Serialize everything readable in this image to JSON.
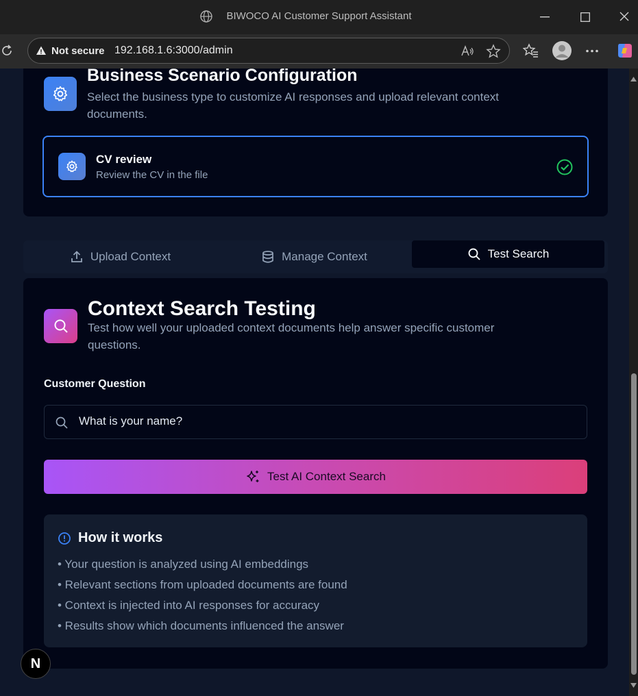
{
  "window": {
    "title": "BIWOCO AI Customer Support Assistant"
  },
  "browser": {
    "security_label": "Not secure",
    "url": "192.168.1.6:3000/admin"
  },
  "business_config": {
    "title": "Business Scenario Configuration",
    "subtitle_line1": "Select the business type to customize AI responses and upload relevant context",
    "subtitle_line2": "documents.",
    "selected_option": {
      "title": "CV review",
      "description": "Review the CV in the file"
    }
  },
  "tabs": [
    {
      "label": "Upload Context",
      "icon": "upload-icon"
    },
    {
      "label": "Manage Context",
      "icon": "database-icon"
    },
    {
      "label": "Test Search",
      "icon": "search-icon",
      "active": true
    }
  ],
  "search_testing": {
    "title": "Context Search Testing",
    "subtitle_line1": "Test how well your uploaded context documents help answer specific customer",
    "subtitle_line2": "questions.",
    "question_label": "Customer Question",
    "question_value": "What is your name?",
    "button_label": "Test AI Context Search"
  },
  "how_it_works": {
    "title": "How it works",
    "items": [
      "• Your question is analyzed using AI embeddings",
      "• Relevant sections from uploaded documents are found",
      "• Context is injected into AI responses for accuracy",
      "• Results show which documents influenced the answer"
    ]
  },
  "dev_badge": "N",
  "colors": {
    "accent": "#3b82f6",
    "success": "#22c55e",
    "gradient_start": "#a855f7",
    "gradient_end": "#db3f7a"
  }
}
